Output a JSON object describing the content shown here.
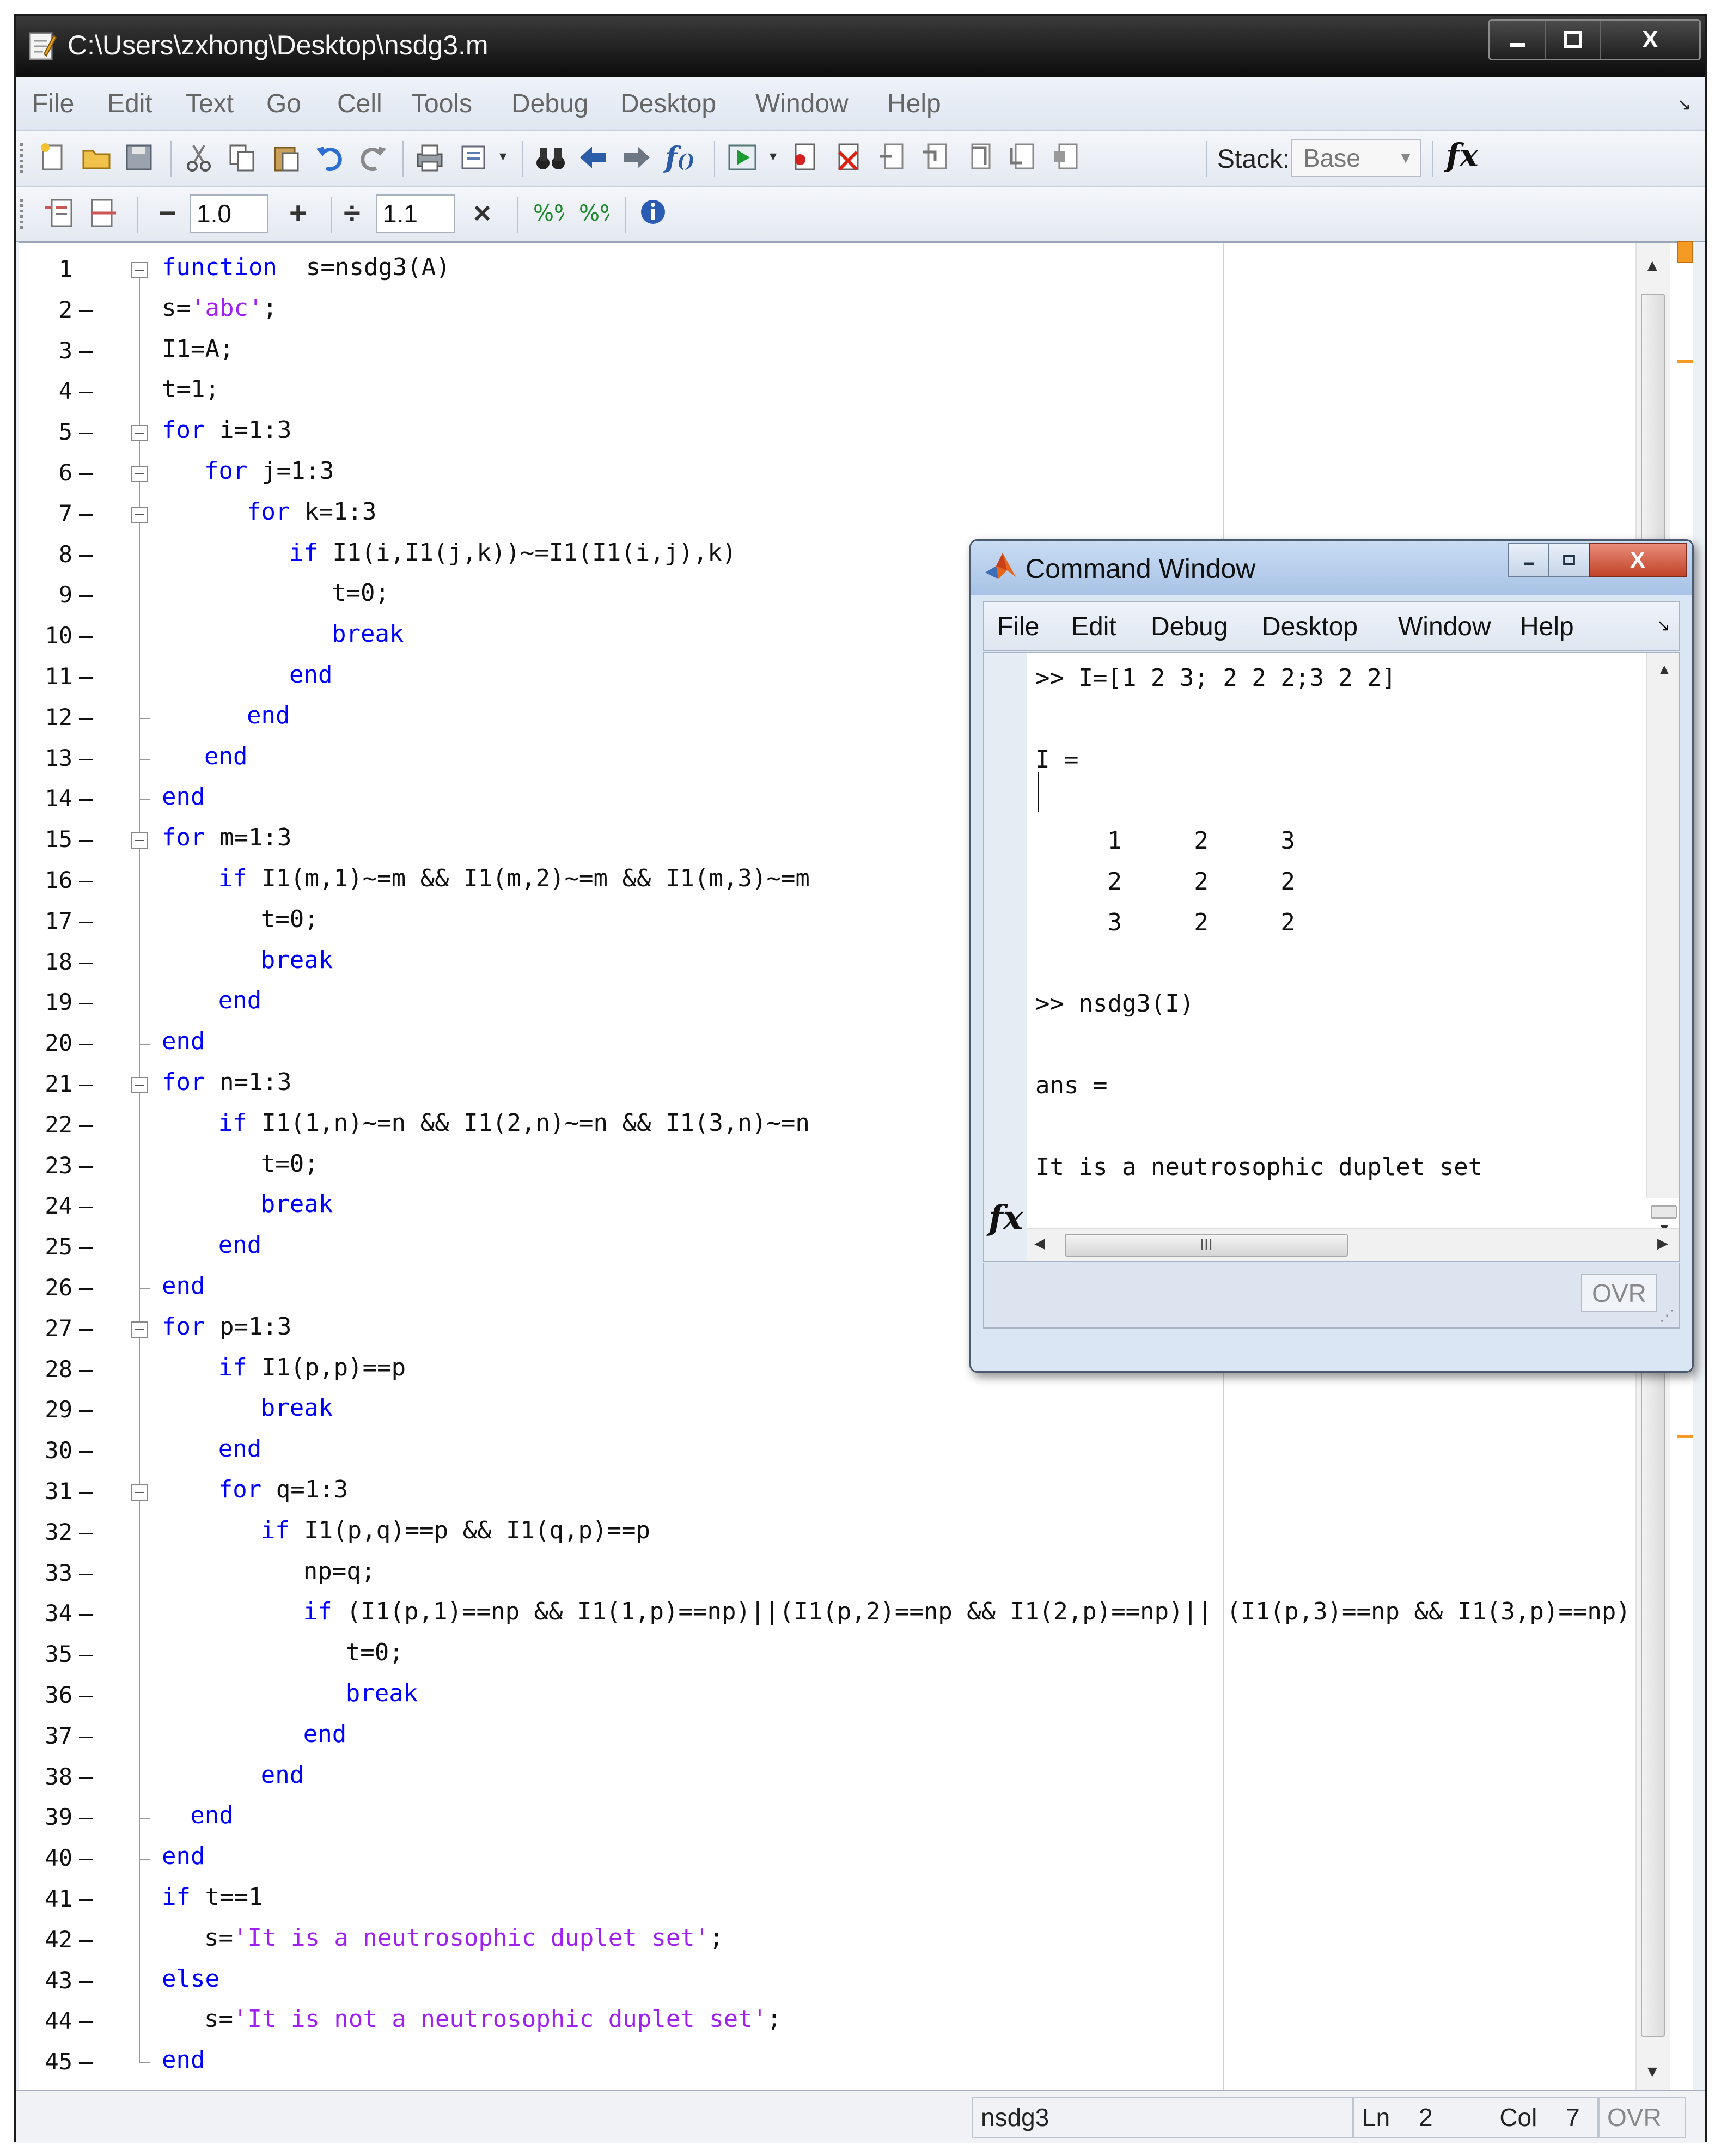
{
  "window": {
    "title": "C:\\Users\\zxhong\\Desktop\\nsdg3.m",
    "minimize_icon": "minimize-icon",
    "maximize_icon": "maximize-icon",
    "close_glyph": "X"
  },
  "menu": [
    "File",
    "Edit",
    "Text",
    "Go",
    "Cell",
    "Tools",
    "Debug",
    "Desktop",
    "Window",
    "Help"
  ],
  "toolbar": {
    "stack_label": "Stack:",
    "stack_value": "Base",
    "fx_label": "fx"
  },
  "cell_toolbar": {
    "minus": "−",
    "decrement_value": "1.0",
    "plus": "+",
    "divide": "÷",
    "multiplier_value": "1.1",
    "times": "×"
  },
  "editor": {
    "lines": [
      {
        "n": "1",
        "indent": 0,
        "segs": [
          [
            "kw",
            "function"
          ],
          [
            "",
            "  s=nsdg3(A)"
          ]
        ]
      },
      {
        "n": "2",
        "indent": 0,
        "segs": [
          [
            "",
            "s="
          ],
          [
            "str",
            "'abc'"
          ],
          [
            "",
            ";"
          ]
        ]
      },
      {
        "n": "3",
        "indent": 0,
        "segs": [
          [
            "",
            "I1=A;"
          ]
        ]
      },
      {
        "n": "4",
        "indent": 0,
        "segs": [
          [
            "",
            "t=1;"
          ]
        ]
      },
      {
        "n": "5",
        "indent": 0,
        "segs": [
          [
            "kw",
            "for"
          ],
          [
            "",
            " i=1:3"
          ]
        ]
      },
      {
        "n": "6",
        "indent": 1,
        "segs": [
          [
            "kw",
            "for"
          ],
          [
            "",
            " j=1:3"
          ]
        ]
      },
      {
        "n": "7",
        "indent": 2,
        "segs": [
          [
            "kw",
            "for"
          ],
          [
            "",
            " k=1:3"
          ]
        ]
      },
      {
        "n": "8",
        "indent": 3,
        "segs": [
          [
            "kw",
            "if"
          ],
          [
            "",
            " I1(i,I1(j,k))~=I1(I1(i,j),k)"
          ]
        ]
      },
      {
        "n": "9",
        "indent": 4,
        "segs": [
          [
            "",
            "t=0;"
          ]
        ]
      },
      {
        "n": "10",
        "indent": 4,
        "segs": [
          [
            "kw",
            "break"
          ]
        ]
      },
      {
        "n": "11",
        "indent": 3,
        "segs": [
          [
            "kw",
            "end"
          ]
        ]
      },
      {
        "n": "12",
        "indent": 2,
        "segs": [
          [
            "kw",
            "end"
          ]
        ]
      },
      {
        "n": "13",
        "indent": 1,
        "segs": [
          [
            "kw",
            "end"
          ]
        ]
      },
      {
        "n": "14",
        "indent": 0,
        "segs": [
          [
            "kw",
            "end"
          ]
        ]
      },
      {
        "n": "15",
        "indent": 0,
        "segs": [
          [
            "kw",
            "for"
          ],
          [
            "",
            " m=1:3"
          ]
        ]
      },
      {
        "n": "16",
        "indent": 1.33,
        "segs": [
          [
            "kw",
            "if"
          ],
          [
            "",
            " I1(m,1)~=m && I1(m,2)~=m && I1(m,3)~=m"
          ]
        ]
      },
      {
        "n": "17",
        "indent": 2.33,
        "segs": [
          [
            "",
            "t=0;"
          ]
        ]
      },
      {
        "n": "18",
        "indent": 2.33,
        "segs": [
          [
            "kw",
            "break"
          ]
        ]
      },
      {
        "n": "19",
        "indent": 1.33,
        "segs": [
          [
            "kw",
            "end"
          ]
        ]
      },
      {
        "n": "20",
        "indent": 0,
        "segs": [
          [
            "kw",
            "end"
          ]
        ]
      },
      {
        "n": "21",
        "indent": 0,
        "segs": [
          [
            "kw",
            "for"
          ],
          [
            "",
            " n=1:3"
          ]
        ]
      },
      {
        "n": "22",
        "indent": 1.33,
        "segs": [
          [
            "kw",
            "if"
          ],
          [
            "",
            " I1(1,n)~=n && I1(2,n)~=n && I1(3,n)~=n"
          ]
        ]
      },
      {
        "n": "23",
        "indent": 2.33,
        "segs": [
          [
            "",
            "t=0;"
          ]
        ]
      },
      {
        "n": "24",
        "indent": 2.33,
        "segs": [
          [
            "kw",
            "break"
          ]
        ]
      },
      {
        "n": "25",
        "indent": 1.33,
        "segs": [
          [
            "kw",
            "end"
          ]
        ]
      },
      {
        "n": "26",
        "indent": 0,
        "segs": [
          [
            "kw",
            "end"
          ]
        ]
      },
      {
        "n": "27",
        "indent": 0,
        "segs": [
          [
            "kw",
            "for"
          ],
          [
            "",
            " p=1:3"
          ]
        ]
      },
      {
        "n": "28",
        "indent": 1.33,
        "segs": [
          [
            "kw",
            "if"
          ],
          [
            "",
            " I1(p,p)==p"
          ]
        ]
      },
      {
        "n": "29",
        "indent": 2.33,
        "segs": [
          [
            "kw",
            "break"
          ]
        ]
      },
      {
        "n": "30",
        "indent": 1.33,
        "segs": [
          [
            "kw",
            "end"
          ]
        ]
      },
      {
        "n": "31",
        "indent": 1.33,
        "segs": [
          [
            "kw",
            "for"
          ],
          [
            "",
            " q=1:3"
          ]
        ]
      },
      {
        "n": "32",
        "indent": 2.33,
        "segs": [
          [
            "kw",
            "if"
          ],
          [
            "",
            " I1(p,q)==p && I1(q,p)==p"
          ]
        ]
      },
      {
        "n": "33",
        "indent": 3.33,
        "segs": [
          [
            "",
            "np=q;"
          ]
        ]
      },
      {
        "n": "34",
        "indent": 3.33,
        "segs": [
          [
            "kw",
            "if"
          ],
          [
            "",
            " (I1(p,1)==np && I1(1,p)==np)||(I1(p,2)==np && I1(2,p)==np)|| (I1(p,3)==np && I1(3,p)==np)"
          ]
        ]
      },
      {
        "n": "35",
        "indent": 4.33,
        "segs": [
          [
            "",
            "t=0;"
          ]
        ]
      },
      {
        "n": "36",
        "indent": 4.33,
        "segs": [
          [
            "kw",
            "break"
          ]
        ]
      },
      {
        "n": "37",
        "indent": 3.33,
        "segs": [
          [
            "kw",
            "end"
          ]
        ]
      },
      {
        "n": "38",
        "indent": 2.33,
        "segs": [
          [
            "kw",
            "end"
          ]
        ]
      },
      {
        "n": "39",
        "indent": 0.67,
        "segs": [
          [
            "kw",
            "end"
          ]
        ]
      },
      {
        "n": "40",
        "indent": 0,
        "segs": [
          [
            "kw",
            "end"
          ]
        ]
      },
      {
        "n": "41",
        "indent": 0,
        "segs": [
          [
            "kw",
            "if"
          ],
          [
            "",
            " t==1"
          ]
        ]
      },
      {
        "n": "42",
        "indent": 1,
        "segs": [
          [
            "",
            "s="
          ],
          [
            "str",
            "'It is a neutrosophic duplet set'"
          ],
          [
            "",
            ";"
          ]
        ]
      },
      {
        "n": "43",
        "indent": 0,
        "segs": [
          [
            "kw",
            "else"
          ]
        ]
      },
      {
        "n": "44",
        "indent": 1,
        "segs": [
          [
            "",
            "s="
          ],
          [
            "str",
            "'It is not a neutrosophic duplet set'"
          ],
          [
            "",
            ";"
          ]
        ]
      },
      {
        "n": "45",
        "indent": 0,
        "segs": [
          [
            "kw",
            "end"
          ]
        ]
      }
    ],
    "breakpoint_lines": [
      "2",
      "3",
      "4",
      "5",
      "6",
      "7",
      "8",
      "9",
      "10",
      "11",
      "12",
      "13",
      "14",
      "15",
      "16",
      "17",
      "18",
      "19",
      "20",
      "21",
      "22",
      "23",
      "24",
      "25",
      "26",
      "27",
      "28",
      "29",
      "30",
      "31",
      "32",
      "33",
      "34",
      "35",
      "36",
      "37",
      "38",
      "39",
      "40",
      "41",
      "42",
      "43",
      "44",
      "45"
    ]
  },
  "statusbar": {
    "file": "nsdg3",
    "ln_label": "Ln",
    "ln_value": "2",
    "col_label": "Col",
    "col_value": "7",
    "ovr": "OVR"
  },
  "command_window": {
    "title": "Command Window",
    "menu": [
      "File",
      "Edit",
      "Debug",
      "Desktop",
      "Window",
      "Help"
    ],
    "lines": [
      ">> I=[1 2 3; 2 2 2;3 2 2]",
      "",
      "I =",
      "",
      "     1     2     3",
      "     2     2     2",
      "     3     2     2",
      "",
      ">> nsdg3(I)",
      "",
      "ans =",
      "",
      "It is a neutrosophic duplet set",
      "",
      ">>"
    ],
    "fx_label": "fx",
    "hscroll_grip": "III",
    "ovr": "OVR"
  },
  "colors": {
    "keyword": "#0000ff",
    "string": "#a020f0",
    "accent_marker": "#f59a23"
  }
}
